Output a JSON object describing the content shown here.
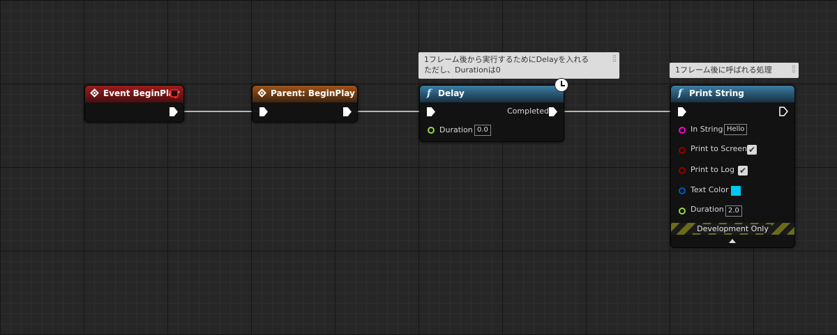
{
  "nodes": {
    "event_begin_play": {
      "title": "Event BeginPlay",
      "color": "#9a1c1c"
    },
    "parent_begin_play": {
      "title": "Parent: BeginPlay",
      "color": "#a0541a"
    },
    "delay": {
      "title": "Delay",
      "color": "#3b7da3",
      "completed_label": "Completed",
      "duration_label": "Duration",
      "duration_value": "0.0"
    },
    "print_string": {
      "title": "Print String",
      "color": "#3b7da3",
      "in_string_label": "In String",
      "in_string_value": "Hello",
      "print_to_screen_label": "Print to Screen",
      "print_to_screen_checked": true,
      "print_to_log_label": "Print to Log",
      "print_to_log_checked": true,
      "text_color_label": "Text Color",
      "text_color_value": "#00c8f8",
      "duration_label": "Duration",
      "duration_value": "2.0",
      "development_only_label": "Development Only"
    }
  },
  "comments": {
    "delay_comment_line1": "1フレーム後から実行するためにDelayを入れる",
    "delay_comment_line2": "ただし、Durationは0",
    "print_comment": "1フレーム後に呼ばれる処理"
  },
  "icons": {
    "event": "event-diamond-icon",
    "function": "function-f-icon",
    "latent": "clock-icon",
    "delegate": "delegate-square-icon",
    "expand": "triangle-up-icon",
    "comment_pin": "pin-icon"
  },
  "pin_colors": {
    "float": "#9cd83a",
    "string": "#ff00d4",
    "bool": "#950000",
    "struct": "#0058c8",
    "exec": "#ffffff"
  }
}
